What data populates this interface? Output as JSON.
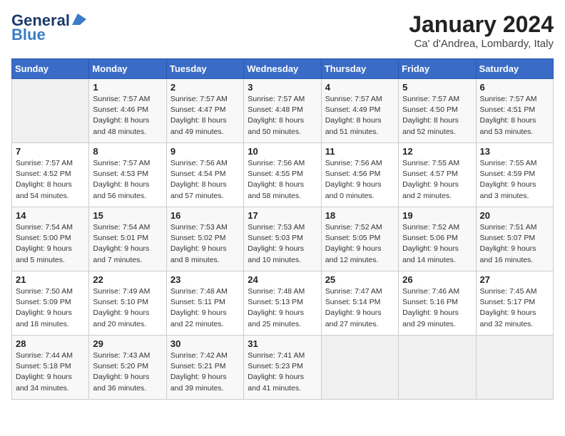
{
  "header": {
    "logo_general": "General",
    "logo_blue": "Blue",
    "title": "January 2024",
    "location": "Ca' d'Andrea, Lombardy, Italy"
  },
  "weekdays": [
    "Sunday",
    "Monday",
    "Tuesday",
    "Wednesday",
    "Thursday",
    "Friday",
    "Saturday"
  ],
  "weeks": [
    [
      {
        "day": "",
        "info": ""
      },
      {
        "day": "1",
        "info": "Sunrise: 7:57 AM\nSunset: 4:46 PM\nDaylight: 8 hours\nand 48 minutes."
      },
      {
        "day": "2",
        "info": "Sunrise: 7:57 AM\nSunset: 4:47 PM\nDaylight: 8 hours\nand 49 minutes."
      },
      {
        "day": "3",
        "info": "Sunrise: 7:57 AM\nSunset: 4:48 PM\nDaylight: 8 hours\nand 50 minutes."
      },
      {
        "day": "4",
        "info": "Sunrise: 7:57 AM\nSunset: 4:49 PM\nDaylight: 8 hours\nand 51 minutes."
      },
      {
        "day": "5",
        "info": "Sunrise: 7:57 AM\nSunset: 4:50 PM\nDaylight: 8 hours\nand 52 minutes."
      },
      {
        "day": "6",
        "info": "Sunrise: 7:57 AM\nSunset: 4:51 PM\nDaylight: 8 hours\nand 53 minutes."
      }
    ],
    [
      {
        "day": "7",
        "info": "Sunrise: 7:57 AM\nSunset: 4:52 PM\nDaylight: 8 hours\nand 54 minutes."
      },
      {
        "day": "8",
        "info": "Sunrise: 7:57 AM\nSunset: 4:53 PM\nDaylight: 8 hours\nand 56 minutes."
      },
      {
        "day": "9",
        "info": "Sunrise: 7:56 AM\nSunset: 4:54 PM\nDaylight: 8 hours\nand 57 minutes."
      },
      {
        "day": "10",
        "info": "Sunrise: 7:56 AM\nSunset: 4:55 PM\nDaylight: 8 hours\nand 58 minutes."
      },
      {
        "day": "11",
        "info": "Sunrise: 7:56 AM\nSunset: 4:56 PM\nDaylight: 9 hours\nand 0 minutes."
      },
      {
        "day": "12",
        "info": "Sunrise: 7:55 AM\nSunset: 4:57 PM\nDaylight: 9 hours\nand 2 minutes."
      },
      {
        "day": "13",
        "info": "Sunrise: 7:55 AM\nSunset: 4:59 PM\nDaylight: 9 hours\nand 3 minutes."
      }
    ],
    [
      {
        "day": "14",
        "info": "Sunrise: 7:54 AM\nSunset: 5:00 PM\nDaylight: 9 hours\nand 5 minutes."
      },
      {
        "day": "15",
        "info": "Sunrise: 7:54 AM\nSunset: 5:01 PM\nDaylight: 9 hours\nand 7 minutes."
      },
      {
        "day": "16",
        "info": "Sunrise: 7:53 AM\nSunset: 5:02 PM\nDaylight: 9 hours\nand 8 minutes."
      },
      {
        "day": "17",
        "info": "Sunrise: 7:53 AM\nSunset: 5:03 PM\nDaylight: 9 hours\nand 10 minutes."
      },
      {
        "day": "18",
        "info": "Sunrise: 7:52 AM\nSunset: 5:05 PM\nDaylight: 9 hours\nand 12 minutes."
      },
      {
        "day": "19",
        "info": "Sunrise: 7:52 AM\nSunset: 5:06 PM\nDaylight: 9 hours\nand 14 minutes."
      },
      {
        "day": "20",
        "info": "Sunrise: 7:51 AM\nSunset: 5:07 PM\nDaylight: 9 hours\nand 16 minutes."
      }
    ],
    [
      {
        "day": "21",
        "info": "Sunrise: 7:50 AM\nSunset: 5:09 PM\nDaylight: 9 hours\nand 18 minutes."
      },
      {
        "day": "22",
        "info": "Sunrise: 7:49 AM\nSunset: 5:10 PM\nDaylight: 9 hours\nand 20 minutes."
      },
      {
        "day": "23",
        "info": "Sunrise: 7:48 AM\nSunset: 5:11 PM\nDaylight: 9 hours\nand 22 minutes."
      },
      {
        "day": "24",
        "info": "Sunrise: 7:48 AM\nSunset: 5:13 PM\nDaylight: 9 hours\nand 25 minutes."
      },
      {
        "day": "25",
        "info": "Sunrise: 7:47 AM\nSunset: 5:14 PM\nDaylight: 9 hours\nand 27 minutes."
      },
      {
        "day": "26",
        "info": "Sunrise: 7:46 AM\nSunset: 5:16 PM\nDaylight: 9 hours\nand 29 minutes."
      },
      {
        "day": "27",
        "info": "Sunrise: 7:45 AM\nSunset: 5:17 PM\nDaylight: 9 hours\nand 32 minutes."
      }
    ],
    [
      {
        "day": "28",
        "info": "Sunrise: 7:44 AM\nSunset: 5:18 PM\nDaylight: 9 hours\nand 34 minutes."
      },
      {
        "day": "29",
        "info": "Sunrise: 7:43 AM\nSunset: 5:20 PM\nDaylight: 9 hours\nand 36 minutes."
      },
      {
        "day": "30",
        "info": "Sunrise: 7:42 AM\nSunset: 5:21 PM\nDaylight: 9 hours\nand 39 minutes."
      },
      {
        "day": "31",
        "info": "Sunrise: 7:41 AM\nSunset: 5:23 PM\nDaylight: 9 hours\nand 41 minutes."
      },
      {
        "day": "",
        "info": ""
      },
      {
        "day": "",
        "info": ""
      },
      {
        "day": "",
        "info": ""
      }
    ]
  ]
}
